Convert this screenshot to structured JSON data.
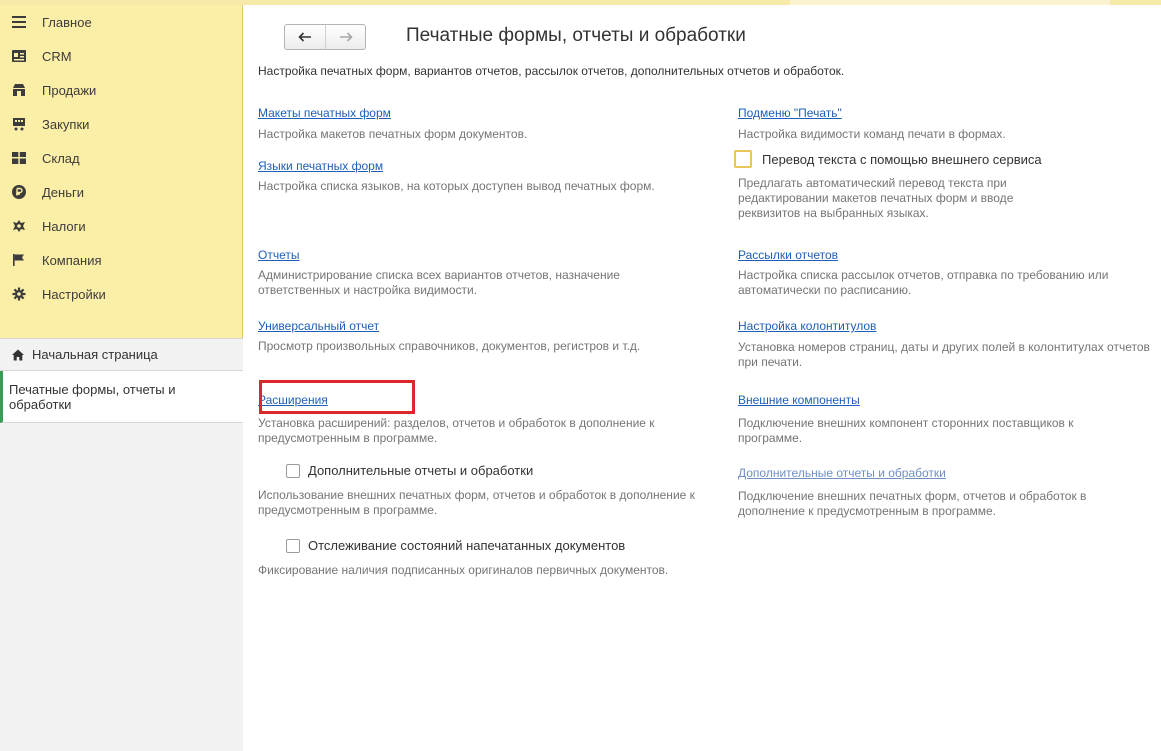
{
  "sidebar": {
    "sections": [
      {
        "label": "Главное",
        "icon": "menu-icon"
      },
      {
        "label": "CRM",
        "icon": "crm-card-icon"
      },
      {
        "label": "Продажи",
        "icon": "sales-icon"
      },
      {
        "label": "Закупки",
        "icon": "purchases-icon"
      },
      {
        "label": "Склад",
        "icon": "warehouse-icon"
      },
      {
        "label": "Деньги",
        "icon": "money-icon"
      },
      {
        "label": "Налоги",
        "icon": "taxes-icon"
      },
      {
        "label": "Компания",
        "icon": "company-flag-icon"
      },
      {
        "label": "Настройки",
        "icon": "settings-gear-icon"
      }
    ],
    "home_label": "Начальная страница",
    "open_page_label": "Печатные формы, отчеты и обработки"
  },
  "header": {
    "title": "Печатные формы, отчеты и обработки",
    "description": "Настройка печатных форм, вариантов отчетов, рассылок отчетов, дополнительных отчетов и обработок."
  },
  "left_column": {
    "print_layouts": {
      "link": "Макеты печатных форм",
      "desc": "Настройка макетов печатных форм документов."
    },
    "print_languages": {
      "link": "Языки печатных форм",
      "desc": "Настройка списка языков, на которых доступен вывод печатных форм."
    },
    "reports": {
      "link": "Отчеты",
      "desc": "Администрирование списка всех вариантов отчетов, назначение ответственных и настройка видимости."
    },
    "universal_report": {
      "link": "Универсальный отчет",
      "desc": "Просмотр произвольных справочников, документов, регистров и т.д."
    },
    "extensions": {
      "link": "Расширения",
      "desc": "Установка расширений: разделов, отчетов и обработок в дополнение к предусмотренным в программе."
    },
    "additional_reports_option": {
      "label": "Дополнительные отчеты и обработки",
      "checked": false,
      "desc": "Использование внешних печатных форм, отчетов и обработок в дополнение к предусмотренным в программе."
    },
    "tracking_option": {
      "label": "Отслеживание состояний напечатанных документов",
      "checked": false,
      "desc": "Фиксирование наличия подписанных оригиналов первичных документов."
    }
  },
  "right_column": {
    "print_submenu": {
      "link": "Подменю \"Печать\"",
      "desc": "Настройка видимости команд печати в формах."
    },
    "translation_option": {
      "label": "Перевод текста с помощью внешнего сервиса",
      "checked": false,
      "desc": "Предлагать автоматический перевод текста при редактировании макетов печатных форм и вводе реквизитов на выбранных языках."
    },
    "report_mailings": {
      "link": "Рассылки отчетов",
      "desc": "Настройка списка рассылок отчетов, отправка по требованию или автоматически по расписанию."
    },
    "headers_footers": {
      "link": "Настройка колонтитулов",
      "desc": "Установка номеров страниц, даты и других полей в колонтитулах отчетов при печати."
    },
    "external_components": {
      "link": "Внешние компоненты",
      "desc": "Подключение внешних компонент сторонних поставщиков к программе."
    },
    "additional_reports": {
      "link": "Дополнительные отчеты и обработки",
      "desc": "Подключение внешних печатных форм, отчетов и обработок в дополнение к предусмотренным в программе."
    }
  },
  "colors": {
    "sidebar_bg": "#fbeea6",
    "link": "#1e5eb8",
    "highlight_frame": "#e0262d",
    "active_marker": "#3a9a57"
  }
}
